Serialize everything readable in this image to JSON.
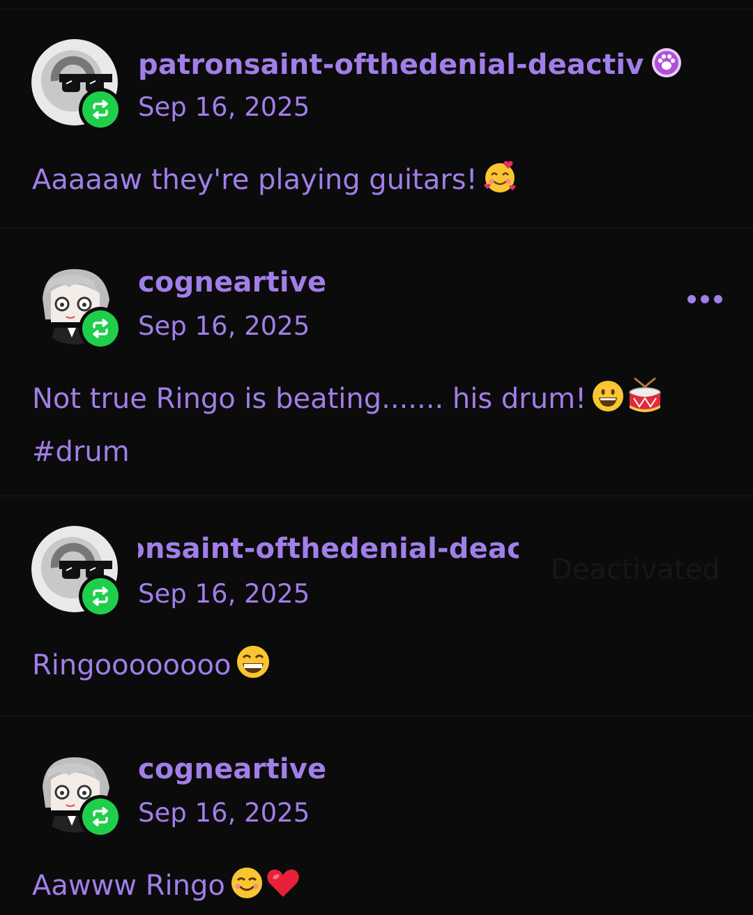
{
  "comments": [
    {
      "username": "patronsaint-ofthedenial-deactiv",
      "date": "Sep 16, 2025",
      "body": "Aaaaaw they're playing guitars!",
      "emoji": [
        "smiling-face-with-hearts"
      ],
      "avatar": "sunglasses-avatar",
      "user_badge": "paw-badge"
    },
    {
      "username": "cogneartive",
      "date": "Sep 16, 2025",
      "body_line1": "Not true Ringo is beating....... his drum!",
      "body_line2": "#drum",
      "emoji": [
        "grinning-face",
        "drum"
      ],
      "avatar": "anime-avatar"
    },
    {
      "username": "patronsaint-ofthedenial-deactiv",
      "username_visible": "saint-ofthedenial-deactiv",
      "date": "Sep 16, 2025",
      "body": "Ringoooooooo",
      "emoji": [
        "beaming-face"
      ],
      "avatar": "sunglasses-avatar",
      "overlay_label": "Deactivated"
    },
    {
      "username": "cogneartive",
      "date": "Sep 16, 2025",
      "body": "Aawww Ringo",
      "emoji": [
        "smiling-face",
        "red-heart"
      ],
      "avatar": "anime-avatar"
    }
  ],
  "colors": {
    "background": "#0b0b0c",
    "accent": "#a27ee8",
    "reblog_green": "#1fcf4b"
  }
}
